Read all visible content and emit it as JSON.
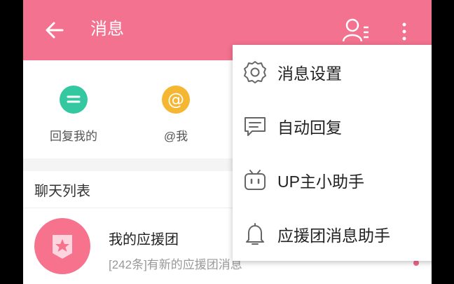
{
  "header": {
    "title": "消息"
  },
  "quick_actions": [
    {
      "label": "回复我的",
      "icon": "reply-bubble-icon",
      "color": "#33c8a0"
    },
    {
      "label": "@我",
      "icon": "at-icon",
      "color": "#f5b731"
    }
  ],
  "chat_list": {
    "title": "聊天列表",
    "items": [
      {
        "name": "我的应援团",
        "preview": "[242条]有新的应援团消息"
      }
    ]
  },
  "menu": {
    "items": [
      {
        "label": "消息设置",
        "icon": "gear-icon"
      },
      {
        "label": "自动回复",
        "icon": "chat-bubble-icon"
      },
      {
        "label": "UP主小助手",
        "icon": "tv-icon"
      },
      {
        "label": "应援团消息助手",
        "icon": "bell-icon"
      }
    ]
  },
  "colors": {
    "accent": "#f3728f",
    "badge_dot": "#f06787"
  }
}
